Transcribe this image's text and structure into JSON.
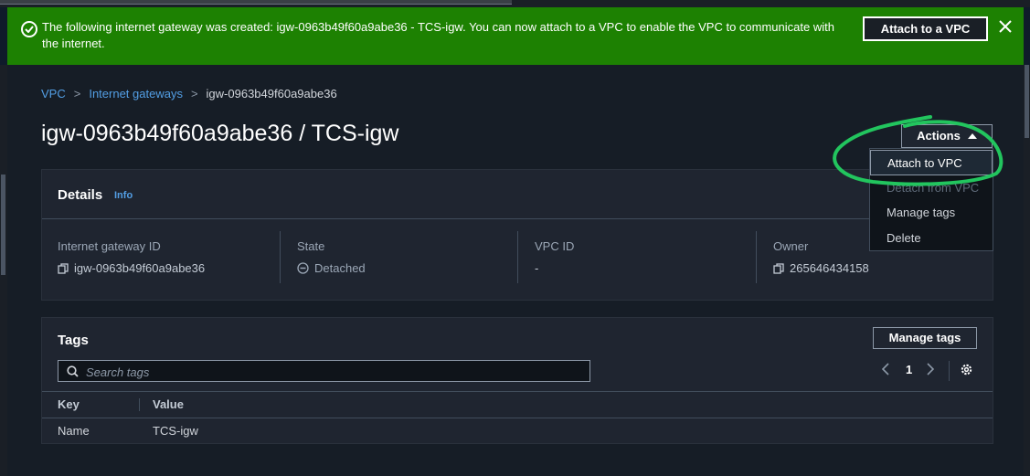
{
  "banner": {
    "message": "The following internet gateway was created: igw-0963b49f60a9abe36 - TCS-igw. You can now attach to a VPC to enable the VPC to communicate with the internet.",
    "attach_button": "Attach to a VPC",
    "success_icon": "check-circle-icon",
    "close_icon": "close-icon",
    "color": "#1d8102"
  },
  "breadcrumb": {
    "items": [
      "VPC",
      "Internet gateways"
    ],
    "current": "igw-0963b49f60a9abe36"
  },
  "page": {
    "title": "igw-0963b49f60a9abe36 / TCS-igw",
    "actions_label": "Actions"
  },
  "actions_menu": {
    "items": [
      {
        "label": "Attach to VPC",
        "state": "highlighted"
      },
      {
        "label": "Detach from VPC",
        "state": "disabled"
      },
      {
        "label": "Manage tags",
        "state": "enabled"
      },
      {
        "label": "Delete",
        "state": "enabled"
      }
    ],
    "annotation_color": "#22c55e"
  },
  "details": {
    "heading": "Details",
    "info_link": "Info",
    "fields": [
      {
        "label": "Internet gateway ID",
        "value": "igw-0963b49f60a9abe36",
        "icon": "copy-icon"
      },
      {
        "label": "State",
        "value": "Detached",
        "icon": "minus-circle-icon"
      },
      {
        "label": "VPC ID",
        "value": "-"
      },
      {
        "label": "Owner",
        "value": "265646434158",
        "icon": "copy-icon"
      }
    ]
  },
  "tags": {
    "heading": "Tags",
    "manage_button": "Manage tags",
    "search_placeholder": "Search tags",
    "page_number": "1",
    "columns": [
      "Key",
      "Value"
    ],
    "rows": [
      {
        "key": "Name",
        "value": "TCS-igw"
      }
    ]
  }
}
